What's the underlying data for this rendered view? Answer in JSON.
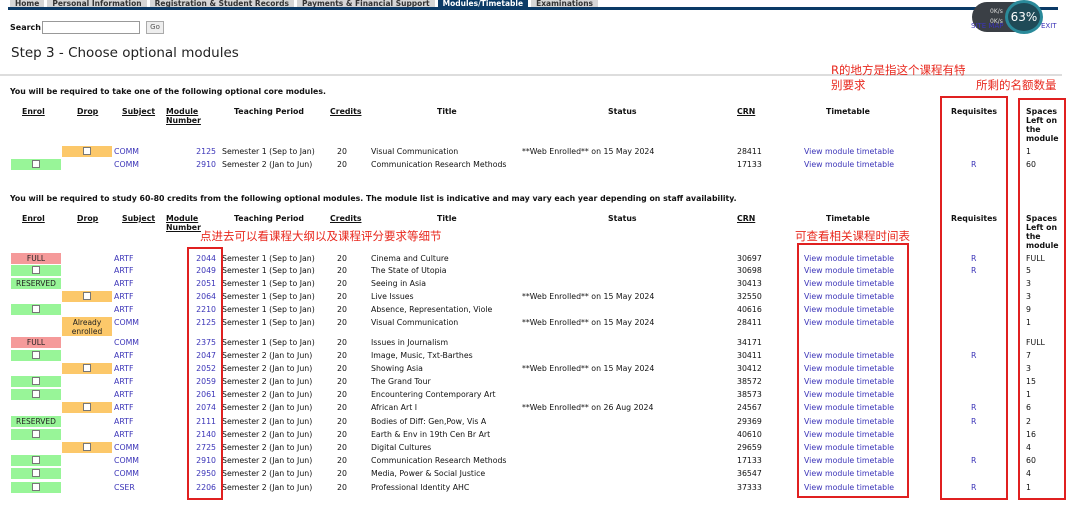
{
  "nav": {
    "tabs": [
      "Home",
      "Personal Information",
      "Registration & Student Records",
      "Payments & Financial Support",
      "Modules/Timetable",
      "Examinations"
    ],
    "active": 4
  },
  "search": {
    "label": "Search",
    "value": "",
    "go": "Go"
  },
  "top_links": {
    "site_map": "SITE MAP",
    "exit": "EXIT"
  },
  "overlay": {
    "up": "0K/s",
    "down": "0K/s",
    "percent": "63%"
  },
  "page_title": "Step 3 - Choose optional modules",
  "headers": {
    "enrol": "Enrol",
    "drop": "Drop",
    "subject": "Subject",
    "module_number": "Module Number",
    "teaching_period": "Teaching Period",
    "credits": "Credits",
    "title": "Title",
    "status": "Status",
    "crn": "CRN",
    "timetable": "Timetable",
    "requisites": "Requisites",
    "spaces": "Spaces Left on the module"
  },
  "section1": {
    "text": "You will be required to take one of the following optional core modules.",
    "rows": [
      {
        "enrol": "",
        "drop": "checkbox",
        "subject": "COMM",
        "number": "2125",
        "period": "Semester 1 (Sep to Jan)",
        "credits": "20",
        "title": "Visual Communication",
        "status": "**Web Enrolled** on 15 May 2024",
        "crn": "28411",
        "timetable": "View module timetable",
        "req": "",
        "spaces": "1"
      },
      {
        "enrol": "checkbox",
        "drop": "",
        "subject": "COMM",
        "number": "2910",
        "period": "Semester 2 (Jan to Jun)",
        "credits": "20",
        "title": "Communication Research Methods",
        "status": "",
        "crn": "17133",
        "timetable": "View module timetable",
        "req": "R",
        "spaces": "60"
      }
    ]
  },
  "section2": {
    "text": "You will be required to study 60-80 credits from the following optional modules. The module list is indicative and may vary each year depending on staff availability.",
    "rows": [
      {
        "enrol": "FULL",
        "drop": "",
        "subject": "ARTF",
        "number": "2044",
        "period": "Semester 1 (Sep to Jan)",
        "credits": "20",
        "title": "Cinema and Culture",
        "status": "",
        "crn": "30697",
        "timetable": "View module timetable",
        "req": "R",
        "spaces": "FULL"
      },
      {
        "enrol": "checkbox",
        "drop": "",
        "subject": "ARTF",
        "number": "2049",
        "period": "Semester 1 (Sep to Jan)",
        "credits": "20",
        "title": "The State of Utopia",
        "status": "",
        "crn": "30698",
        "timetable": "View module timetable",
        "req": "R",
        "spaces": "5"
      },
      {
        "enrol": "RESERVED",
        "drop": "",
        "subject": "ARTF",
        "number": "2051",
        "period": "Semester 1 (Sep to Jan)",
        "credits": "20",
        "title": "Seeing in Asia",
        "status": "",
        "crn": "30413",
        "timetable": "View module timetable",
        "req": "",
        "spaces": "3"
      },
      {
        "enrol": "",
        "drop": "checkbox",
        "subject": "ARTF",
        "number": "2064",
        "period": "Semester 1 (Sep to Jan)",
        "credits": "20",
        "title": "Live Issues",
        "status": "**Web Enrolled** on 15 May 2024",
        "crn": "32550",
        "timetable": "View module timetable",
        "req": "",
        "spaces": "3"
      },
      {
        "enrol": "checkbox",
        "drop": "",
        "subject": "ARTF",
        "number": "2210",
        "period": "Semester 1 (Sep to Jan)",
        "credits": "20",
        "title": "Absence, Representation, Viole",
        "status": "",
        "crn": "40616",
        "timetable": "View module timetable",
        "req": "",
        "spaces": "9"
      },
      {
        "enrol": "",
        "drop": "Already enrolled",
        "subject": "COMM",
        "number": "2125",
        "period": "Semester 1 (Sep to Jan)",
        "credits": "20",
        "title": "Visual Communication",
        "status": "**Web Enrolled** on 15 May 2024",
        "crn": "28411",
        "timetable": "View module timetable",
        "req": "",
        "spaces": "1"
      },
      {
        "enrol": "FULL",
        "drop": "",
        "subject": "COMM",
        "number": "2375",
        "period": "Semester 1 (Sep to Jan)",
        "credits": "20",
        "title": "Issues in Journalism",
        "status": "",
        "crn": "34171",
        "timetable": "",
        "req": "",
        "spaces": "FULL"
      },
      {
        "enrol": "checkbox",
        "drop": "",
        "subject": "ARTF",
        "number": "2047",
        "period": "Semester 2 (Jan to Jun)",
        "credits": "20",
        "title": "Image, Music, Txt-Barthes",
        "status": "",
        "crn": "30411",
        "timetable": "View module timetable",
        "req": "R",
        "spaces": "7"
      },
      {
        "enrol": "",
        "drop": "checkbox",
        "subject": "ARTF",
        "number": "2052",
        "period": "Semester 2 (Jan to Jun)",
        "credits": "20",
        "title": "Showing Asia",
        "status": "**Web Enrolled** on 15 May 2024",
        "crn": "30412",
        "timetable": "View module timetable",
        "req": "",
        "spaces": "3"
      },
      {
        "enrol": "checkbox",
        "drop": "",
        "subject": "ARTF",
        "number": "2059",
        "period": "Semester 2 (Jan to Jun)",
        "credits": "20",
        "title": "The Grand Tour",
        "status": "",
        "crn": "38572",
        "timetable": "View module timetable",
        "req": "",
        "spaces": "15"
      },
      {
        "enrol": "checkbox",
        "drop": "",
        "subject": "ARTF",
        "number": "2061",
        "period": "Semester 2 (Jan to Jun)",
        "credits": "20",
        "title": "Encountering Contemporary Art",
        "status": "",
        "crn": "38573",
        "timetable": "View module timetable",
        "req": "",
        "spaces": "1"
      },
      {
        "enrol": "",
        "drop": "checkbox",
        "subject": "ARTF",
        "number": "2074",
        "period": "Semester 2 (Jan to Jun)",
        "credits": "20",
        "title": "African Art I",
        "status": "**Web Enrolled** on 26 Aug 2024",
        "crn": "24567",
        "timetable": "View module timetable",
        "req": "R",
        "spaces": "6"
      },
      {
        "enrol": "RESERVED",
        "drop": "",
        "subject": "ARTF",
        "number": "2111",
        "period": "Semester 2 (Jan to Jun)",
        "credits": "20",
        "title": "Bodies of Diff: Gen,Pow, Vis A",
        "status": "",
        "crn": "29369",
        "timetable": "View module timetable",
        "req": "R",
        "spaces": "2"
      },
      {
        "enrol": "checkbox",
        "drop": "",
        "subject": "ARTF",
        "number": "2140",
        "period": "Semester 2 (Jan to Jun)",
        "credits": "20",
        "title": "Earth & Env in 19th Cen Br Art",
        "status": "",
        "crn": "40610",
        "timetable": "View module timetable",
        "req": "",
        "spaces": "16"
      },
      {
        "enrol": "",
        "drop": "checkbox",
        "subject": "COMM",
        "number": "2725",
        "period": "Semester 2 (Jan to Jun)",
        "credits": "20",
        "title": "Digital Cultures",
        "status": "",
        "crn": "29659",
        "timetable": "View module timetable",
        "req": "",
        "spaces": "4"
      },
      {
        "enrol": "checkbox",
        "drop": "",
        "subject": "COMM",
        "number": "2910",
        "period": "Semester 2 (Jan to Jun)",
        "credits": "20",
        "title": "Communication Research Methods",
        "status": "",
        "crn": "17133",
        "timetable": "View module timetable",
        "req": "R",
        "spaces": "60"
      },
      {
        "enrol": "checkbox",
        "drop": "",
        "subject": "COMM",
        "number": "2950",
        "period": "Semester 2 (Jan to Jun)",
        "credits": "20",
        "title": "Media, Power & Social Justice",
        "status": "",
        "crn": "36547",
        "timetable": "View module timetable",
        "req": "",
        "spaces": "4"
      },
      {
        "enrol": "checkbox",
        "drop": "",
        "subject": "CSER",
        "number": "2206",
        "period": "Semester 2 (Jan to Jun)",
        "credits": "20",
        "title": "Professional Identity AHC",
        "status": "",
        "crn": "37333",
        "timetable": "View module timetable",
        "req": "R",
        "spaces": "1"
      }
    ]
  },
  "annotations": {
    "requisites": "R的地方是指这个课程有特别要求",
    "spaces": "所剩的名额数量",
    "module_number": "点进去可以看课程大纲以及课程评分要求等细节",
    "timetable": "可查看相关课程时间表"
  },
  "colors": {
    "full": "#f59a9a",
    "available": "#98f598",
    "enrolled": "#fcc86a",
    "link": "#3b34b8",
    "annotation": "#e8281e",
    "nav_active": "#0b3a66"
  }
}
